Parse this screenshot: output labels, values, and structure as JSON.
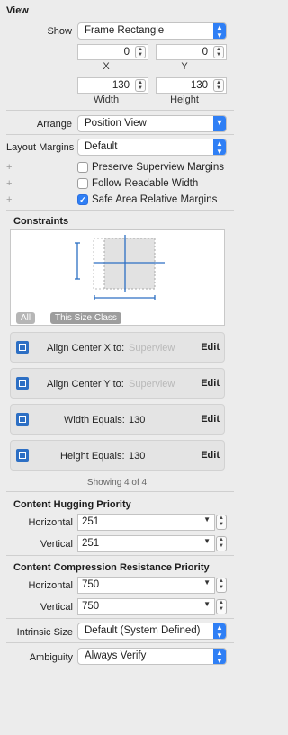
{
  "view": {
    "title": "View",
    "show_label": "Show",
    "show_value": "Frame Rectangle",
    "x_value": "0",
    "x_label": "X",
    "y_value": "0",
    "y_label": "Y",
    "width_value": "130",
    "width_label": "Width",
    "height_value": "130",
    "height_label": "Height",
    "arrange_label": "Arrange",
    "arrange_value": "Position View",
    "margins_label": "Layout Margins",
    "margins_value": "Default",
    "opt1": "Preserve Superview Margins",
    "opt2": "Follow Readable Width",
    "opt3": "Safe Area Relative Margins",
    "plus": "+"
  },
  "constraints": {
    "title": "Constraints",
    "tag_all": "All",
    "tag_size": "This Size Class",
    "items": [
      {
        "label": "Align Center X to:",
        "value": "Superview",
        "edit": "Edit"
      },
      {
        "label": "Align Center Y to:",
        "value": "Superview",
        "edit": "Edit"
      },
      {
        "label": "Width Equals:",
        "value": "130",
        "edit": "Edit"
      },
      {
        "label": "Height Equals:",
        "value": "130",
        "edit": "Edit"
      }
    ],
    "showing": "Showing 4 of 4"
  },
  "hugging": {
    "title": "Content Hugging Priority",
    "h_label": "Horizontal",
    "h_value": "251",
    "v_label": "Vertical",
    "v_value": "251"
  },
  "compression": {
    "title": "Content Compression Resistance Priority",
    "h_label": "Horizontal",
    "h_value": "750",
    "v_label": "Vertical",
    "v_value": "750"
  },
  "intrinsic": {
    "label": "Intrinsic Size",
    "value": "Default (System Defined)"
  },
  "ambiguity": {
    "label": "Ambiguity",
    "value": "Always Verify"
  },
  "colors": {
    "accent": "#2f7ff5",
    "constraint": "#2d6fc4"
  }
}
